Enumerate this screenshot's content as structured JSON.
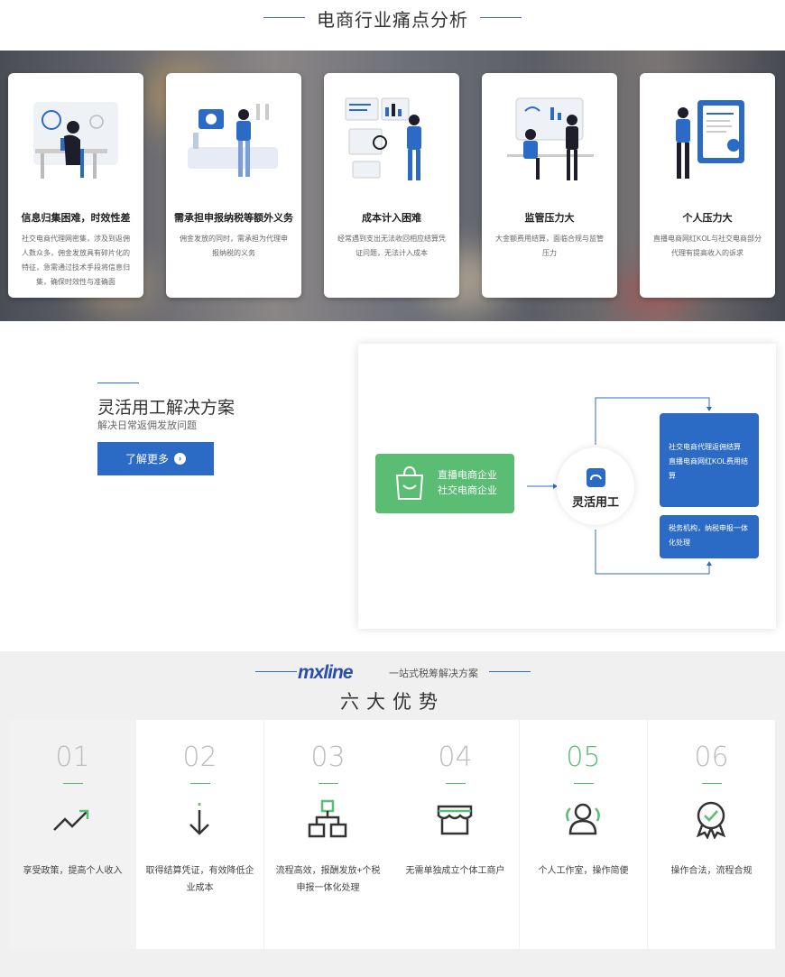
{
  "pain_section": {
    "title": "电商行业痛点分析",
    "cards": [
      {
        "title": "信息归集困难，时效性差",
        "desc": "社交电商代理网密集，涉及到返佣人数众多，佣金发放具有碎片化的特征，急需通过技术手段将信息归集，确保时效性与准确面"
      },
      {
        "title": "需承担申报纳税等额外义务",
        "desc": "佣金发放的同时，需承担为代理申报纳税的义务"
      },
      {
        "title": "成本计入困难",
        "desc": "经常遇到支出无法收回相应结算凭证问题，无法计入成本"
      },
      {
        "title": "监管压力大",
        "desc": "大金额费用结算，面临合规与监管压力"
      },
      {
        "title": "个人压力大",
        "desc": "直播电商网红KOL与社交电商部分代理有提高收入的诉求"
      }
    ]
  },
  "solution": {
    "title": "灵活用工解决方案",
    "subtitle": "解决日常返佣发放问题",
    "button_label": "了解更多",
    "flow": {
      "left_lines": [
        "直播电商企业",
        "社交电商企业"
      ],
      "center_label": "灵活用工",
      "box_top": [
        "社交电商代理返佣结算",
        "直播电商网红KOL费用结算"
      ],
      "box_bottom": [
        "税务机构，纳税申报一体化处理"
      ]
    }
  },
  "advantages": {
    "brand": "mxline",
    "brand_sub": "一站式税筹解决方案",
    "title": "六大优势",
    "items": [
      {
        "num": "01",
        "text": "享受政策，提高个人收入",
        "icon": "trend-up-icon"
      },
      {
        "num": "02",
        "text": "取得结算凭证，有效降低企业成本",
        "icon": "arrow-down-icon"
      },
      {
        "num": "03",
        "text": "流程高效，报酬发放+个税申报一体化处理",
        "icon": "org-chart-icon"
      },
      {
        "num": "04",
        "text": "无需单独成立个体工商户",
        "icon": "store-icon"
      },
      {
        "num": "05",
        "text": "个人工作室，操作简便",
        "icon": "users-icon"
      },
      {
        "num": "06",
        "text": "操作合法，流程合规",
        "icon": "badge-check-icon"
      }
    ]
  },
  "colors": {
    "brand_blue": "#2b6bc5",
    "accent_green": "#5bbd74"
  }
}
